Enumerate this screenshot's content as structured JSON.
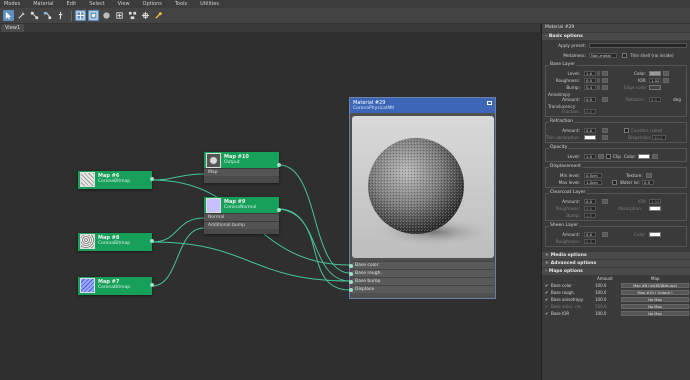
{
  "menu": [
    "Modes",
    "Material",
    "Edit",
    "Select",
    "View",
    "Options",
    "Tools",
    "Utilities"
  ],
  "toolbar": {
    "icons": [
      "select-arrow-icon",
      "picker-icon",
      "link-icon",
      "layout-icon",
      "pin-icon",
      "grid-view-icon",
      "material-view-icon",
      "sphere-view-icon",
      "hand-icon",
      "zoom-fit-icon",
      "move-children-icon",
      "show-map-icon"
    ],
    "accent": "#5d8fbd"
  },
  "view_tab": "View1",
  "nodes": {
    "map6": {
      "title": "Map #6",
      "subtitle": "CoronaBitmap"
    },
    "map8": {
      "title": "Map #8",
      "subtitle": "CoronaBitmap"
    },
    "map7": {
      "title": "Map #7",
      "subtitle": "CoronaBitmap"
    },
    "map10": {
      "title": "Map #10",
      "subtitle": "Output",
      "ports": [
        "Map"
      ]
    },
    "map9": {
      "title": "Map #9",
      "subtitle": "CoronaNormal",
      "ports": [
        "Normal",
        "Additional bump"
      ]
    },
    "material": {
      "title": "Material #29",
      "subtitle": "CoronaPhysicalMtl",
      "ports": [
        "Base color",
        "Base rough.",
        "Base bump",
        "Displace"
      ]
    },
    "header_color": "#17a05a",
    "material_header_color": "#3c66b8"
  },
  "panel": {
    "title": "Material #29",
    "basic": {
      "header": "Basic options",
      "apply_preset_label": "Apply preset:",
      "metalness_label": "Metalness:",
      "metalness_value": "Non-metal",
      "thin_shell_label": "Thin shell (no inside)",
      "base_layer": {
        "label": "Base Layer",
        "level_label": "Level:",
        "level": "1.0",
        "color_label": "Color:",
        "roughness_label": "Roughness:",
        "roughness": "0.0",
        "ior_label": "IOR:",
        "ior": "1.52",
        "bump_label": "Bump:",
        "bump": "0.4",
        "edge_color_label": "Edge color:"
      },
      "anisotropy": {
        "label": "Anisotropy",
        "amount_label": "Amount:",
        "amount": "0.0",
        "rotation_label": "Rotation:",
        "rotation": "0.0",
        "deg": "deg"
      },
      "translucency": {
        "label": "Translucency",
        "fraction_label": "Fraction:",
        "fraction": "0.0"
      },
      "refraction": {
        "label": "Refraction",
        "amount_label": "Amount:",
        "amount": "0.0",
        "caustics_label": "Caustics (slow)",
        "thin_abs_label": "Thin absorption:",
        "dispersion_label": "Dispersion:",
        "dispersion": "40.0"
      },
      "opacity": {
        "label": "Opacity",
        "level_label": "Level:",
        "level": "1.0",
        "clip_label": "Clip",
        "color_label": "Color:"
      },
      "displacement": {
        "label": "Displacement",
        "min_label": "Min level:",
        "min": "0.5cm",
        "texture_label": "Texture:",
        "max_label": "Max level:",
        "max": "1.0cm",
        "water_label": "Water lvl:",
        "water": "0.5"
      },
      "clearcoat": {
        "label": "Clearcoat Layer",
        "amount_label": "Amount:",
        "amount": "0.0",
        "ior_label": "IOR:",
        "ior": "1.50",
        "roughness_label": "Roughness:",
        "roughness": "0.0",
        "absorption_label": "Absorption:",
        "bump_label": "Bump:",
        "bump": "1.0"
      },
      "sheen": {
        "label": "Sheen Layer",
        "amount_label": "Amount:",
        "amount": "0.0",
        "color_label": "Color:",
        "roughness_label": "Roughness:",
        "roughness": "0.3"
      }
    },
    "media_options": "Media options",
    "advanced_options": "Advanced options",
    "maps_options": "Maps options",
    "maps_table": {
      "amount_col": "Amount",
      "map_col": "Map",
      "rows": [
        {
          "name": "Base color",
          "amount": "100.0",
          "map": "Map #6 (uix3638db.jpg)"
        },
        {
          "name": "Base rough.",
          "amount": "100.0",
          "map": "Map #10 ( Output )"
        },
        {
          "name": "Base anisotropy",
          "amount": "100.0",
          "map": "No Map"
        },
        {
          "name": "Base aniso. rot.",
          "amount": "100.0",
          "map": "No Map"
        },
        {
          "name": "Base IOR",
          "amount": "100.0",
          "map": "No Map"
        }
      ]
    }
  }
}
